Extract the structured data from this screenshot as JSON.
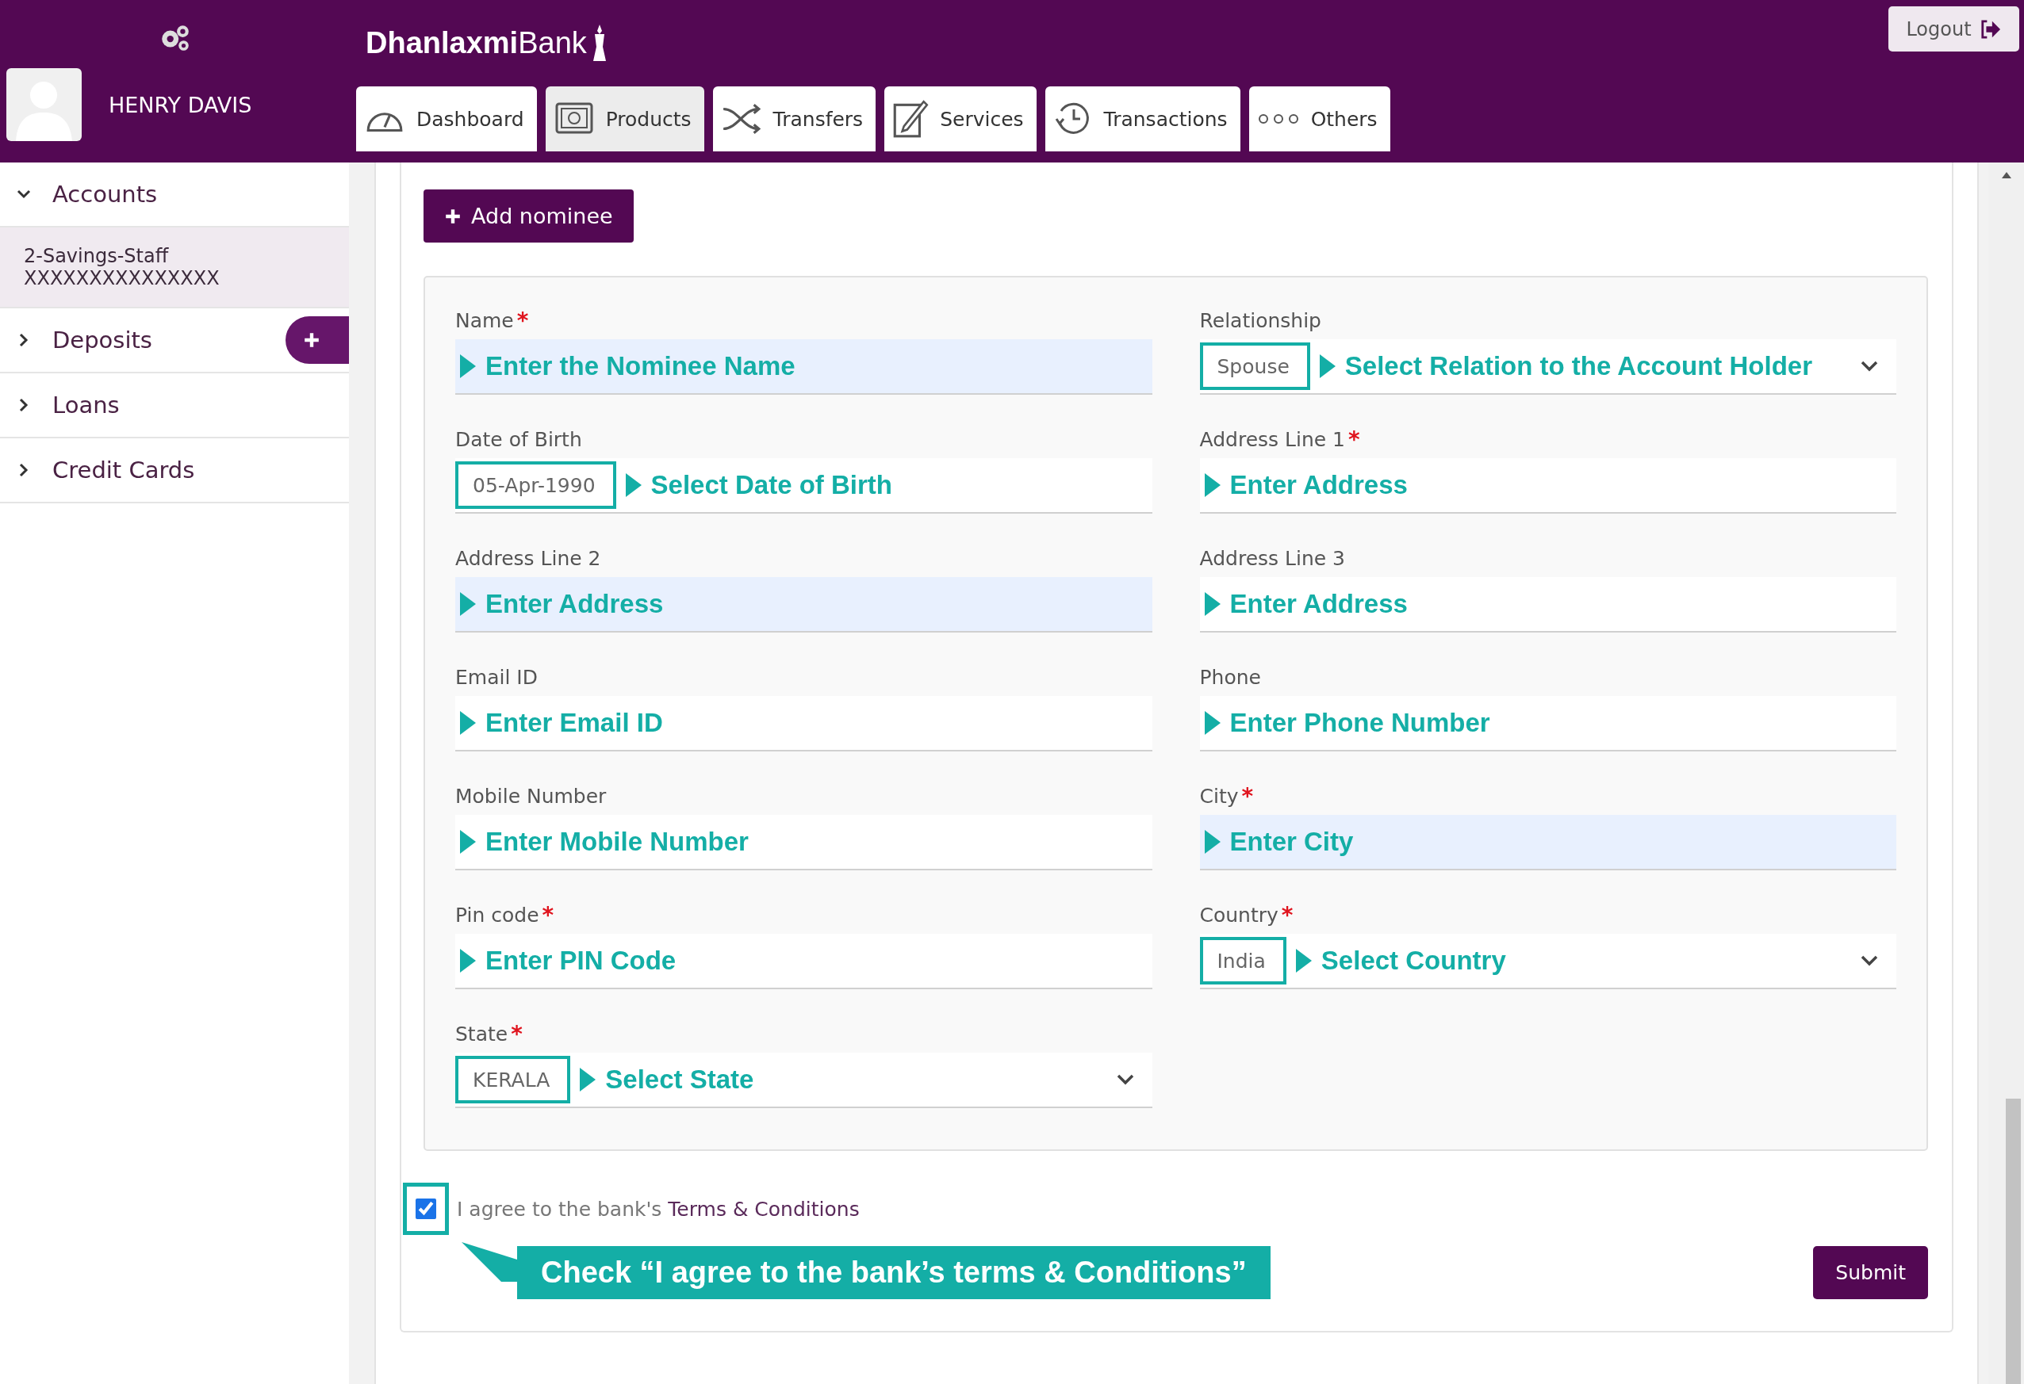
{
  "header": {
    "user": "HENRY DAVIS",
    "logo": "**Dhanlaxmi**Bank",
    "logout": "Logout"
  },
  "tabs": [
    {
      "label": "Dashboard",
      "kind": "gauge",
      "selected": false
    },
    {
      "label": "Products",
      "kind": "safe",
      "selected": true
    },
    {
      "label": "Transfers",
      "kind": "shuffle",
      "selected": false
    },
    {
      "label": "Services",
      "kind": "pen",
      "selected": false
    },
    {
      "label": "Transactions",
      "kind": "history",
      "selected": false
    },
    {
      "label": "Others",
      "kind": "dots",
      "selected": false
    }
  ],
  "sidebar": {
    "items": [
      {
        "label": "Accounts",
        "expanded": true,
        "children": [
          {
            "name": "2-Savings-Staff",
            "number": "XXXXXXXXXXXXXXX",
            "selected": true
          }
        ]
      },
      {
        "label": "Deposits",
        "expanded": false,
        "add_button": true
      },
      {
        "label": "Loans",
        "expanded": false
      },
      {
        "label": "Credit Cards",
        "expanded": false
      }
    ]
  },
  "add_nominee": "Add nominee",
  "fields": [
    {
      "label": "Name",
      "required_mark": "*",
      "kind": "text",
      "autofilled": true,
      "annotation": "Enter the Nominee Name"
    },
    {
      "label": "Relationship",
      "kind": "select",
      "value": "Spouse",
      "autofilled": false,
      "annotation": "Select Relation to the Account Holder"
    },
    {
      "label": "Date of Birth",
      "kind": "date",
      "value": "05-Apr-1990",
      "autofilled": false,
      "annotation": "Select Date of Birth"
    },
    {
      "label": "Address Line 1",
      "required_mark": "*",
      "kind": "text",
      "autofilled": false,
      "annotation": "Enter Address"
    },
    {
      "label": "Address Line 2",
      "kind": "text",
      "autofilled": true,
      "annotation": "Enter Address"
    },
    {
      "label": "Address Line 3",
      "kind": "text",
      "autofilled": false,
      "annotation": "Enter Address"
    },
    {
      "label": "Email ID",
      "kind": "text",
      "autofilled": false,
      "annotation": "Enter Email ID"
    },
    {
      "label": "Phone",
      "kind": "text",
      "autofilled": false,
      "annotation": "Enter Phone Number"
    },
    {
      "label": "Mobile Number",
      "kind": "text",
      "autofilled": false,
      "annotation": "Enter Mobile Number"
    },
    {
      "label": "City",
      "required_mark": "*",
      "kind": "text",
      "autofilled": true,
      "annotation": "Enter City"
    },
    {
      "label": "Pin code",
      "required_mark": "*",
      "kind": "text",
      "autofilled": false,
      "annotation": "Enter PIN Code"
    },
    {
      "label": "Country",
      "required_mark": "*",
      "kind": "select",
      "value": "India",
      "autofilled": false,
      "annotation": "Select Country"
    },
    {
      "label": "State",
      "required_mark": "*",
      "kind": "select",
      "value": "KERALA",
      "autofilled": false,
      "annotation": "Select State"
    }
  ],
  "terms": {
    "checked": true,
    "text": "I agree to the bank's ",
    "link": "Terms & Conditions"
  },
  "callout": "Check “I agree to the bank’s terms & Conditions”",
  "submit": "Submit"
}
